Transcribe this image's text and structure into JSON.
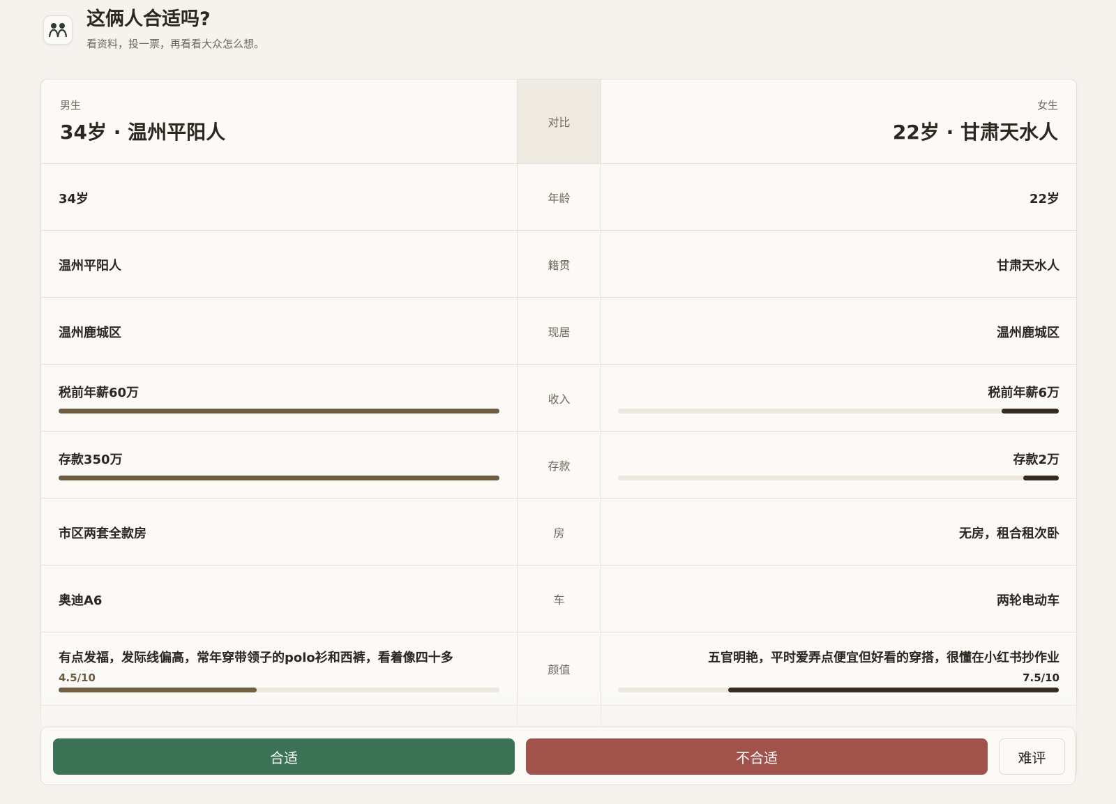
{
  "header": {
    "title": "这俩人合适吗?",
    "subtitle": "看资料，投一票，再看看大众怎么想。",
    "icon": "people-icon"
  },
  "card": {
    "male_label": "男生",
    "male_title": "34岁 · 温州平阳人",
    "compare_label": "对比",
    "female_label": "女生",
    "female_title": "22岁 · 甘肃天水人"
  },
  "rows": {
    "age": {
      "label": "年龄",
      "male": "34岁",
      "female": "22岁"
    },
    "origin": {
      "label": "籍贯",
      "male": "温州平阳人",
      "female": "甘肃天水人"
    },
    "residence": {
      "label": "现居",
      "male": "温州鹿城区",
      "female": "温州鹿城区"
    },
    "income": {
      "label": "收入",
      "male": "税前年薪60万",
      "female": "税前年薪6万",
      "male_level": 1.0,
      "female_level": 0.13
    },
    "savings": {
      "label": "存款",
      "male": "存款350万",
      "female": "存款2万",
      "male_level": 1.0,
      "female_level": 0.08
    },
    "house": {
      "label": "房",
      "male": "市区两套全款房",
      "female": "无房，租合租次卧"
    },
    "car": {
      "label": "车",
      "male": "奥迪A6",
      "female": "两轮电动车"
    },
    "looks": {
      "label": "颜值",
      "male": "有点发福，发际线偏高，常年穿带领子的polo衫和西裤，看着像四十多",
      "female": "五官明艳，平时爱弄点便宜但好看的穿搭，很懂在小红书抄作业",
      "male_score": "4.5/10",
      "female_score": "7.5/10",
      "male_level": 0.45,
      "female_level": 0.75
    }
  },
  "actions": {
    "yes": "合适",
    "no": "不合适",
    "hard": "难评"
  },
  "colors": {
    "yes_button": "#3c7255",
    "no_button": "#a1524a",
    "male_bar": "#6f5e40",
    "female_bar": "#352d24"
  }
}
